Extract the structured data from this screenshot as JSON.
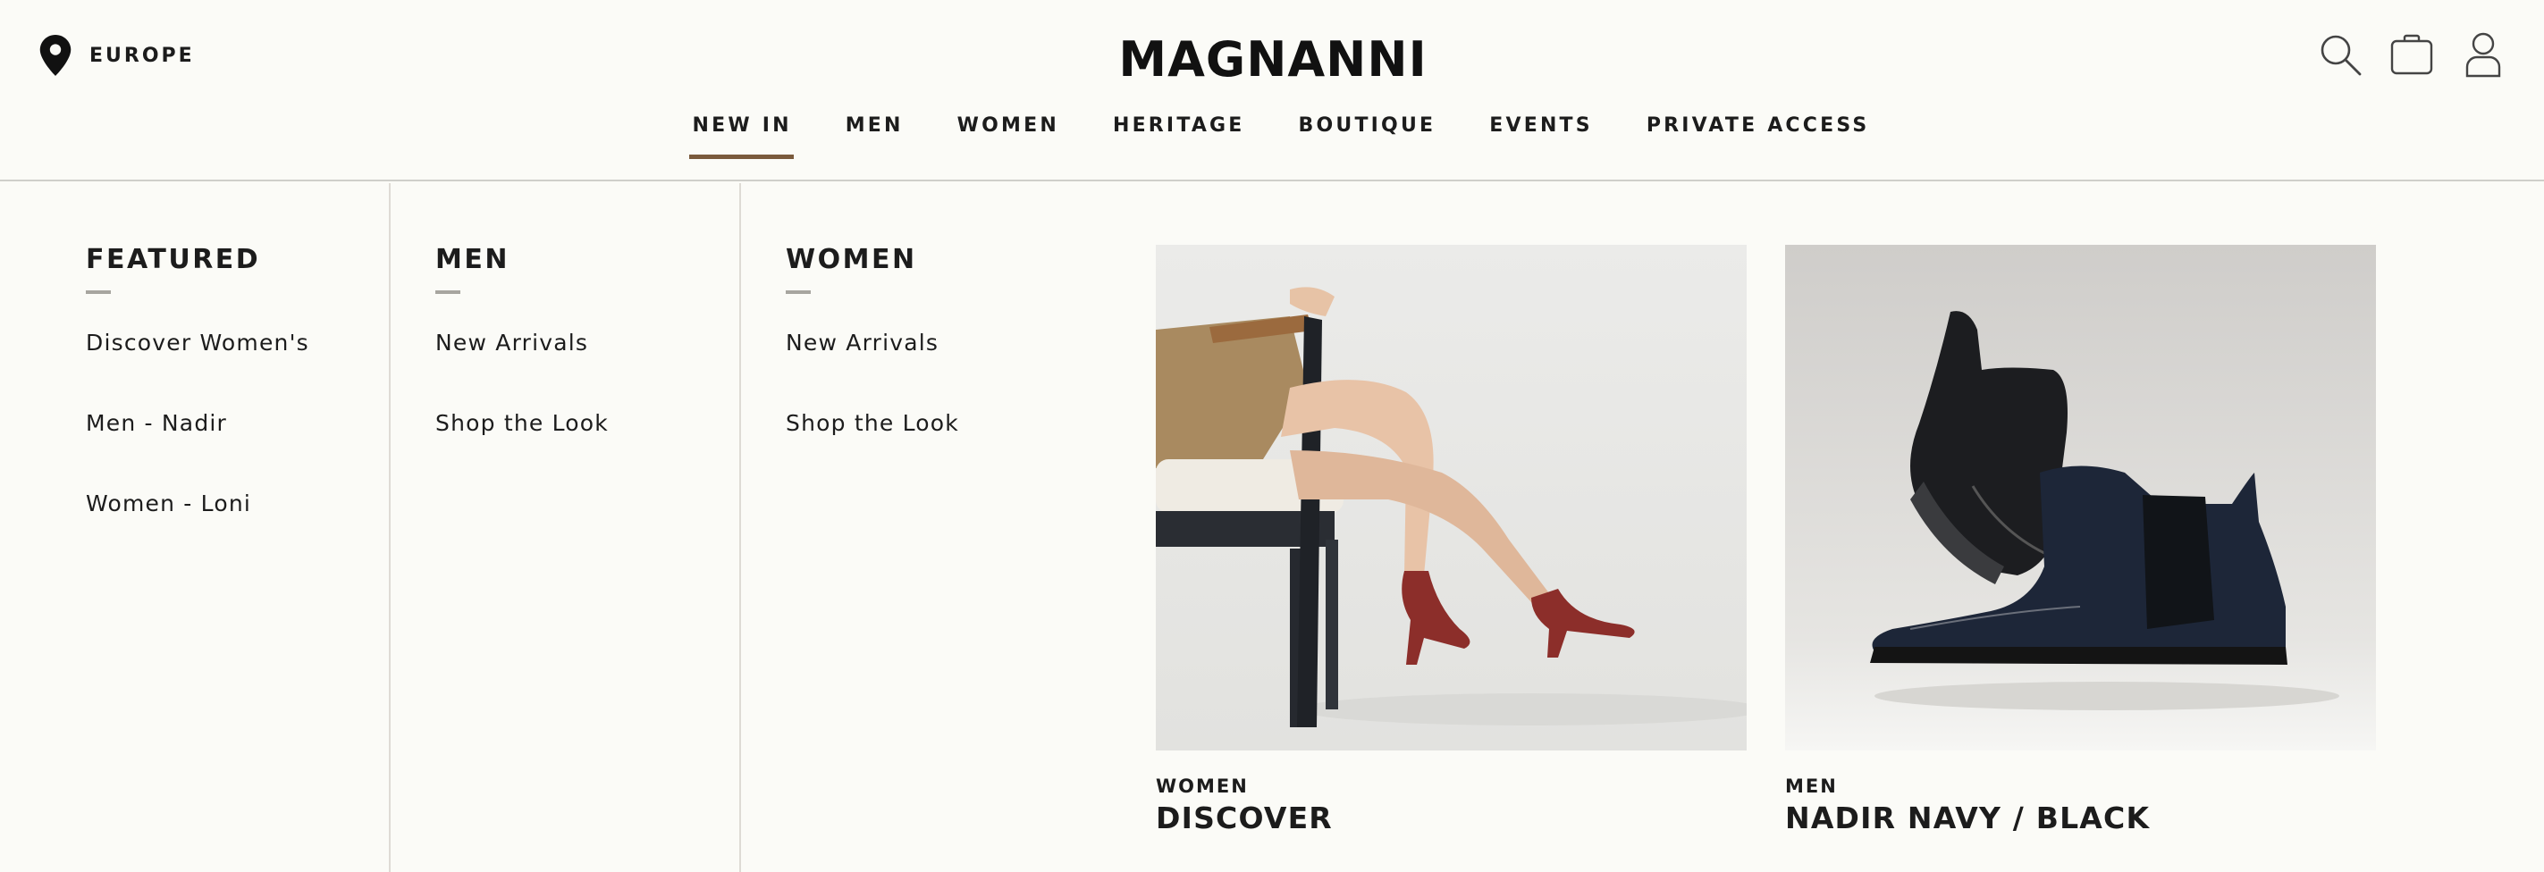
{
  "header": {
    "region": "EUROPE",
    "logo": "MAGNANNI",
    "icons": [
      "map-pin-icon",
      "search-icon",
      "shopping-bag-icon",
      "account-icon"
    ]
  },
  "nav": {
    "active": "NEW IN",
    "items": [
      "NEW IN",
      "MEN",
      "WOMEN",
      "HERITAGE",
      "BOUTIQUE",
      "EVENTS",
      "PRIVATE ACCESS"
    ]
  },
  "menu": {
    "columns": [
      {
        "heading": "FEATURED",
        "links": [
          "Discover Women's",
          "Men - Nadir",
          "Women - Loni"
        ]
      },
      {
        "heading": "MEN",
        "links": [
          "New Arrivals",
          "Shop the Look"
        ]
      },
      {
        "heading": "WOMEN",
        "links": [
          "New Arrivals",
          "Shop the Look"
        ]
      }
    ],
    "cards": [
      {
        "category": "WOMEN",
        "title": "DISCOVER"
      },
      {
        "category": "MEN",
        "title": "NADIR NAVY / BLACK"
      }
    ]
  },
  "colors": {
    "background": "#fbfbf7",
    "text": "#1c1c1c",
    "accent": "#7a5a3c",
    "divider": "#dedbd5"
  }
}
